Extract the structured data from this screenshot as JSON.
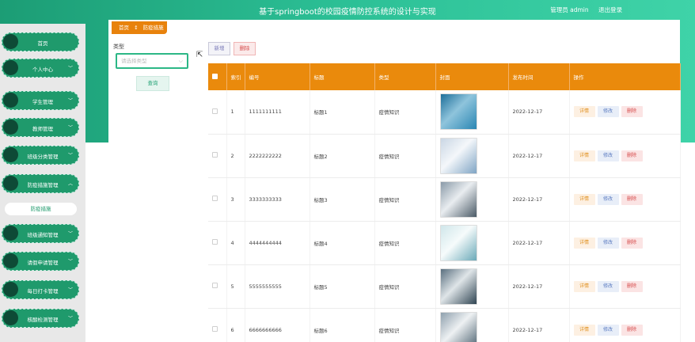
{
  "header": {
    "title": "基于springboot的校园疫情防控系统的设计与实现",
    "user": "管理员 admin",
    "logout": "退出登录"
  },
  "sidebar": {
    "items": [
      {
        "label": "首页",
        "expandable": false
      },
      {
        "label": "个人中心",
        "expandable": true
      },
      {
        "label": "学生管理",
        "expandable": true
      },
      {
        "label": "教师管理",
        "expandable": true
      },
      {
        "label": "班级分类管理",
        "expandable": true
      },
      {
        "label": "防疫措施管理",
        "expandable": true,
        "expanded": true
      },
      {
        "label": "班级通知管理",
        "expandable": true
      },
      {
        "label": "请假申请管理",
        "expandable": true
      },
      {
        "label": "每日打卡管理",
        "expandable": true
      },
      {
        "label": "核酸检测管理",
        "expandable": true
      }
    ],
    "sub_item": "防疫措施"
  },
  "breadcrumb": {
    "home": "首页",
    "sep": "↕",
    "current": "防疫措施"
  },
  "filter": {
    "label": "类型",
    "placeholder": "请选择类型",
    "search_button": "查询"
  },
  "toolbar": {
    "add": "新增",
    "delete": "删除"
  },
  "table": {
    "columns": [
      "",
      "索引",
      "编号",
      "标题",
      "类型",
      "封面",
      "发布时间",
      "操作"
    ],
    "rows": [
      {
        "index": "1",
        "code": "1111111111",
        "title": "标题1",
        "type": "疫情知识",
        "date": "2022-12-17"
      },
      {
        "index": "2",
        "code": "2222222222",
        "title": "标题2",
        "type": "疫情知识",
        "date": "2022-12-17"
      },
      {
        "index": "3",
        "code": "3333333333",
        "title": "标题3",
        "type": "疫情知识",
        "date": "2022-12-17"
      },
      {
        "index": "4",
        "code": "4444444444",
        "title": "标题4",
        "type": "疫情知识",
        "date": "2022-12-17"
      },
      {
        "index": "5",
        "code": "5555555555",
        "title": "标题5",
        "type": "疫情知识",
        "date": "2022-12-17"
      },
      {
        "index": "6",
        "code": "6666666666",
        "title": "标题6",
        "type": "疫情知识",
        "date": "2022-12-17"
      }
    ],
    "actions": {
      "detail": "详情",
      "edit": "修改",
      "delete": "删除"
    }
  },
  "colors": {
    "accent": "#2cb786",
    "table_header": "#ea8a0c",
    "sidebar_item": "#1f9a6c"
  }
}
